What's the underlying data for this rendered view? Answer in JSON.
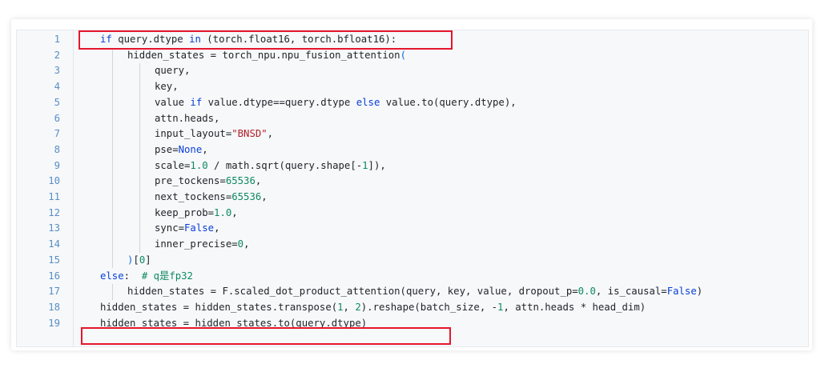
{
  "editor": {
    "line_numbers": [
      "1",
      "2",
      "3",
      "4",
      "5",
      "6",
      "7",
      "8",
      "9",
      "10",
      "11",
      "12",
      "13",
      "14",
      "15",
      "16",
      "17",
      "18",
      "19"
    ],
    "lines": [
      {
        "indent": 1,
        "tokens": [
          [
            "kw",
            "if "
          ],
          [
            "t",
            "query.dtype "
          ],
          [
            "kw",
            "in "
          ],
          [
            "t",
            "(torch.float16, torch.bfloat16):"
          ]
        ]
      },
      {
        "indent": 2,
        "tokens": [
          [
            "t",
            "hidden_states = torch_npu.npu_fusion_attention"
          ],
          [
            "paren",
            "("
          ]
        ]
      },
      {
        "indent": 3,
        "tokens": [
          [
            "t",
            "query,"
          ]
        ]
      },
      {
        "indent": 3,
        "tokens": [
          [
            "t",
            "key,"
          ]
        ]
      },
      {
        "indent": 3,
        "tokens": [
          [
            "t",
            "value "
          ],
          [
            "kw",
            "if "
          ],
          [
            "t",
            "value.dtype==query.dtype "
          ],
          [
            "kw",
            "else "
          ],
          [
            "t",
            "value.to(query.dtype),"
          ]
        ]
      },
      {
        "indent": 3,
        "tokens": [
          [
            "t",
            "attn.heads,"
          ]
        ]
      },
      {
        "indent": 3,
        "tokens": [
          [
            "t",
            "input_layout="
          ],
          [
            "str",
            "\"BNSD\""
          ],
          [
            "t",
            ","
          ]
        ]
      },
      {
        "indent": 3,
        "tokens": [
          [
            "t",
            "pse="
          ],
          [
            "const",
            "None"
          ],
          [
            "t",
            ","
          ]
        ]
      },
      {
        "indent": 3,
        "tokens": [
          [
            "t",
            "scale="
          ],
          [
            "num",
            "1.0"
          ],
          [
            "t",
            " / math.sqrt(query.shape[-"
          ],
          [
            "num",
            "1"
          ],
          [
            "t",
            "]),"
          ]
        ]
      },
      {
        "indent": 3,
        "tokens": [
          [
            "t",
            "pre_tockens="
          ],
          [
            "num",
            "65536"
          ],
          [
            "t",
            ","
          ]
        ]
      },
      {
        "indent": 3,
        "tokens": [
          [
            "t",
            "next_tockens="
          ],
          [
            "num",
            "65536"
          ],
          [
            "t",
            ","
          ]
        ]
      },
      {
        "indent": 3,
        "tokens": [
          [
            "t",
            "keep_prob="
          ],
          [
            "num",
            "1.0"
          ],
          [
            "t",
            ","
          ]
        ]
      },
      {
        "indent": 3,
        "tokens": [
          [
            "t",
            "sync="
          ],
          [
            "const",
            "False"
          ],
          [
            "t",
            ","
          ]
        ]
      },
      {
        "indent": 3,
        "tokens": [
          [
            "t",
            "inner_precise="
          ],
          [
            "num",
            "0"
          ],
          [
            "t",
            ","
          ]
        ]
      },
      {
        "indent": 2,
        "tokens": [
          [
            "paren",
            ")"
          ],
          [
            "t",
            "["
          ],
          [
            "num",
            "0"
          ],
          [
            "t",
            "]"
          ]
        ]
      },
      {
        "indent": 1,
        "tokens": [
          [
            "kw",
            "else"
          ],
          [
            "t",
            ":  "
          ],
          [
            "cmt",
            "# q是fp32"
          ]
        ]
      },
      {
        "indent": 2,
        "tokens": [
          [
            "t",
            "hidden_states = F.scaled_dot_product_attention(query, key, value, dropout_p="
          ],
          [
            "num",
            "0.0"
          ],
          [
            "t",
            ", is_causal="
          ],
          [
            "const",
            "False"
          ],
          [
            "t",
            ")"
          ]
        ]
      },
      {
        "indent": 1,
        "tokens": [
          [
            "t",
            "hidden_states = hidden_states.transpose("
          ],
          [
            "num",
            "1"
          ],
          [
            "t",
            ", "
          ],
          [
            "num",
            "2"
          ],
          [
            "t",
            ").reshape(batch_size, -"
          ],
          [
            "num",
            "1"
          ],
          [
            "t",
            ", attn.heads * head_dim)"
          ]
        ]
      },
      {
        "indent": 1,
        "tokens": [
          [
            "t",
            "hidden_states = hidden_states.to(query.dtype)"
          ]
        ]
      }
    ]
  },
  "colors": {
    "highlight_border": "#e6162d",
    "keyword": "#0a3fd6",
    "number": "#0e8a5f",
    "string": "#b31d28",
    "line_number": "#5a8fc4"
  }
}
